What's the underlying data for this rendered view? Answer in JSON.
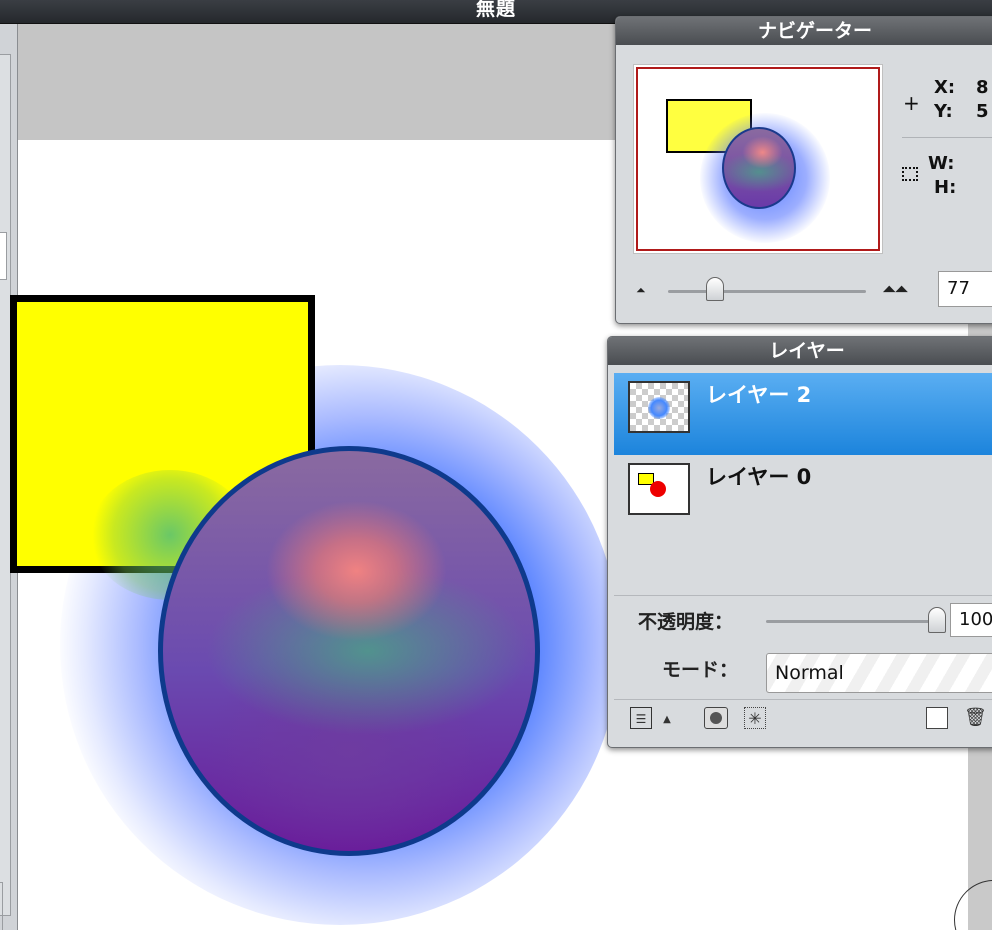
{
  "window": {
    "title": "無題"
  },
  "navigator": {
    "title": "ナビゲーター",
    "x_label": "X:",
    "x_value": "8",
    "y_label": "Y:",
    "y_value": "5",
    "w_label": "W:",
    "h_label": "H:",
    "zoom_value": "77"
  },
  "layers": {
    "title": "レイヤー",
    "items": [
      {
        "name": "レイヤー 2",
        "selected": true
      },
      {
        "name": "レイヤー 0",
        "selected": false
      }
    ],
    "opacity_label": "不透明度：",
    "opacity_value": "100",
    "mode_label": "モード：",
    "mode_value": "Normal"
  },
  "colors": {
    "selected_row": "#1c84dc",
    "shape_fill": "#ffff00",
    "preview_border": "#b01a1a"
  }
}
